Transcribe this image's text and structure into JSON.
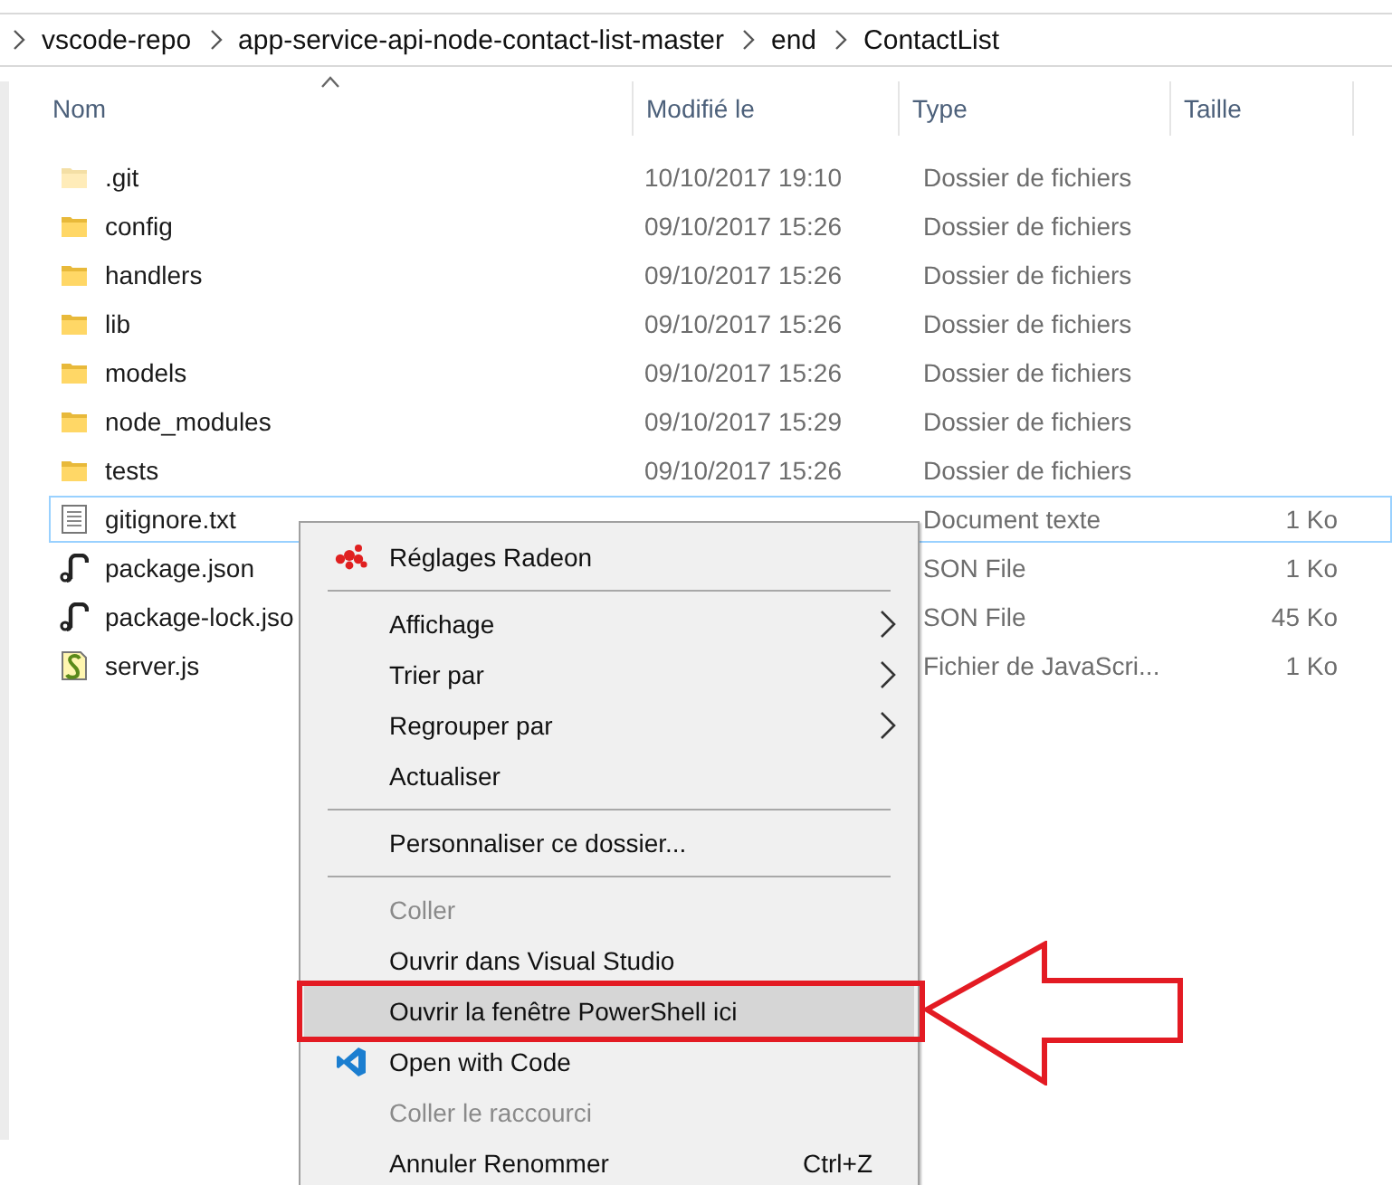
{
  "breadcrumb": [
    "vscode-repo",
    "app-service-api-node-contact-list-master",
    "end",
    "ContactList"
  ],
  "columns": [
    {
      "label": "Nom",
      "sorted": true
    },
    {
      "label": "Modifié le",
      "sorted": false
    },
    {
      "label": "Type",
      "sorted": false
    },
    {
      "label": "Taille",
      "sorted": false
    }
  ],
  "files": [
    {
      "name": ".git",
      "kind": "folder",
      "hidden": true,
      "focused": false,
      "modified": "10/10/2017 19:10",
      "type": "Dossier de fichiers"
    },
    {
      "name": "config",
      "kind": "folder",
      "hidden": false,
      "focused": false,
      "modified": "09/10/2017 15:26",
      "type": "Dossier de fichiers"
    },
    {
      "name": "handlers",
      "kind": "folder",
      "hidden": false,
      "focused": false,
      "modified": "09/10/2017 15:26",
      "type": "Dossier de fichiers"
    },
    {
      "name": "lib",
      "kind": "folder",
      "hidden": false,
      "focused": false,
      "modified": "09/10/2017 15:26",
      "type": "Dossier de fichiers"
    },
    {
      "name": "models",
      "kind": "folder",
      "hidden": false,
      "focused": false,
      "modified": "09/10/2017 15:26",
      "type": "Dossier de fichiers"
    },
    {
      "name": "node_modules",
      "kind": "folder",
      "hidden": false,
      "focused": false,
      "modified": "09/10/2017 15:29",
      "type": "Dossier de fichiers"
    },
    {
      "name": "tests",
      "kind": "folder",
      "hidden": false,
      "focused": false,
      "modified": "09/10/2017 15:26",
      "type": "Dossier de fichiers"
    },
    {
      "name": "gitignore.txt",
      "kind": "text",
      "hidden": false,
      "focused": true,
      "type": "Document texte",
      "size": "1 Ko"
    },
    {
      "name": "package.json",
      "kind": "json",
      "hidden": false,
      "focused": false,
      "type": "SON File",
      "size": "1 Ko"
    },
    {
      "name": "package-lock.jso",
      "kind": "json",
      "hidden": false,
      "focused": false,
      "type": "SON File",
      "size": "45 Ko"
    },
    {
      "name": "server.js",
      "kind": "script",
      "hidden": false,
      "focused": false,
      "type": "Fichier de JavaScri...",
      "size": "1 Ko"
    }
  ],
  "context_menu": [
    {
      "kind": "dots",
      "label": "Réglages Radeon",
      "submenu": false,
      "disabled": false,
      "highlighted": false
    },
    {
      "kind": "separator"
    },
    {
      "kind": "item",
      "label": "Affichage",
      "submenu": true,
      "disabled": false,
      "highlighted": false
    },
    {
      "kind": "item",
      "label": "Trier par",
      "submenu": true,
      "disabled": false,
      "highlighted": false
    },
    {
      "kind": "item",
      "label": "Regrouper par",
      "submenu": true,
      "disabled": false,
      "highlighted": false
    },
    {
      "kind": "item",
      "label": "Actualiser",
      "submenu": false,
      "disabled": false,
      "highlighted": false
    },
    {
      "kind": "separator"
    },
    {
      "kind": "item",
      "label": "Personnaliser ce dossier...",
      "submenu": false,
      "disabled": false,
      "highlighted": false
    },
    {
      "kind": "separator"
    },
    {
      "kind": "item",
      "label": "Coller",
      "submenu": false,
      "disabled": true,
      "highlighted": false
    },
    {
      "kind": "item",
      "label": "Ouvrir dans Visual Studio",
      "submenu": false,
      "disabled": false,
      "highlighted": false
    },
    {
      "kind": "item",
      "label": "Ouvrir la fenêtre PowerShell ici",
      "submenu": false,
      "disabled": false,
      "highlighted": true
    },
    {
      "kind": "ribbon",
      "label": "Open with Code",
      "submenu": false,
      "disabled": false,
      "highlighted": false
    },
    {
      "kind": "item",
      "label": "Coller le raccourci",
      "submenu": false,
      "disabled": true,
      "highlighted": false
    },
    {
      "kind": "item",
      "label": "Annuler Renommer",
      "shortcut": "Ctrl+Z",
      "submenu": false,
      "disabled": false,
      "highlighted": false
    }
  ]
}
